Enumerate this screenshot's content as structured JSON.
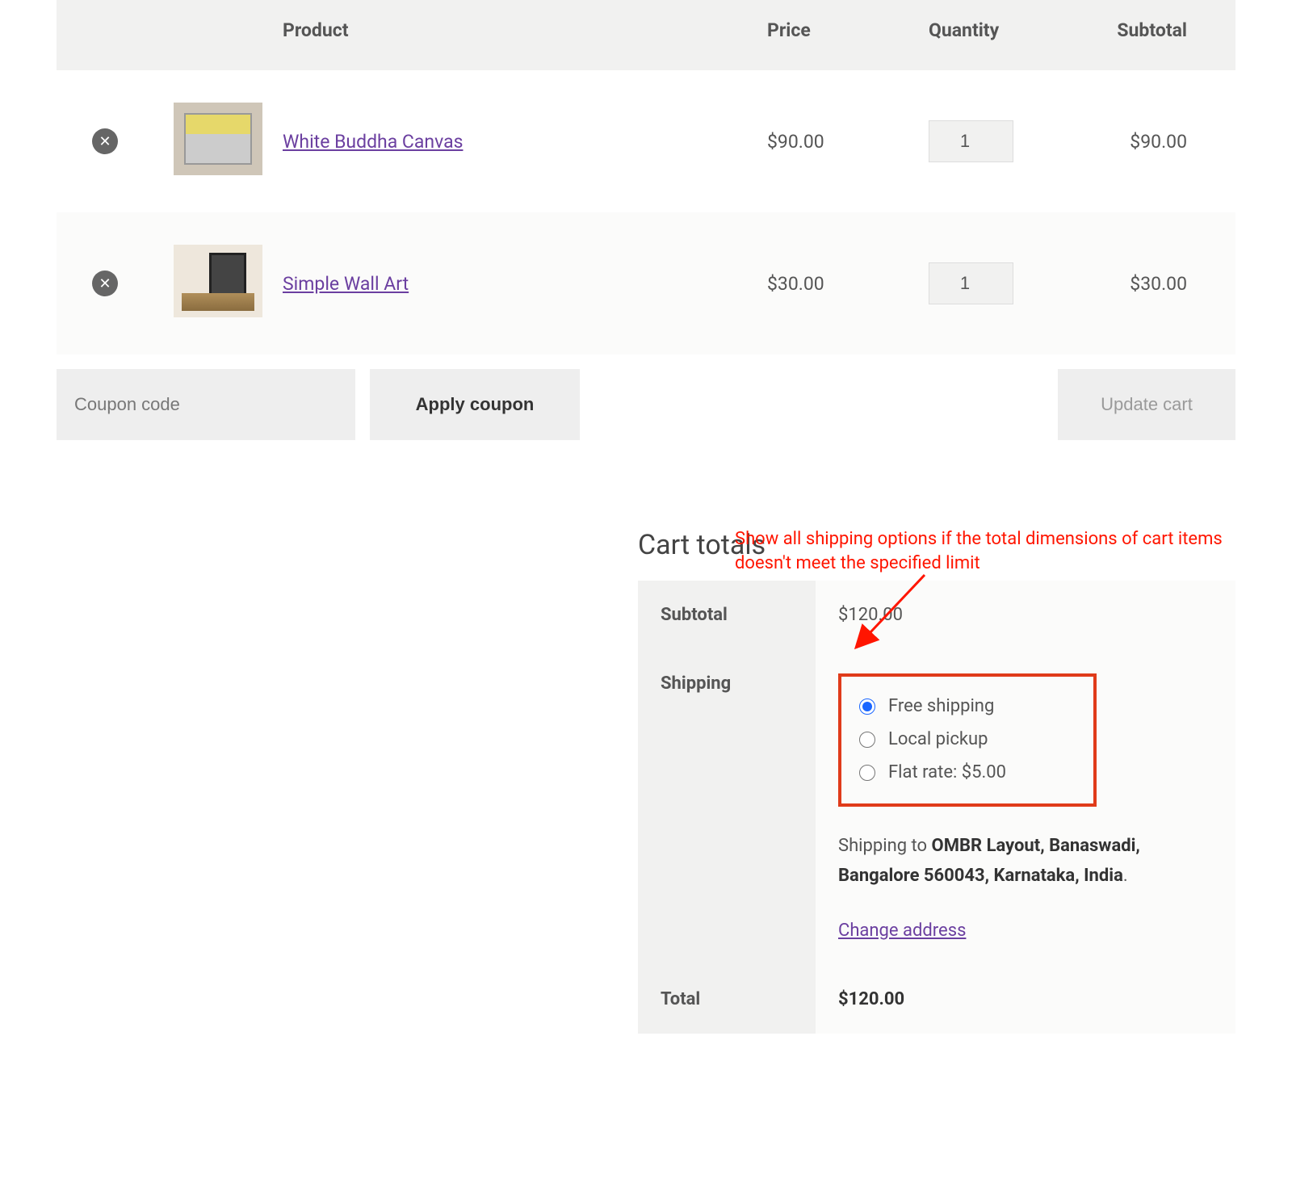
{
  "headers": {
    "product": "Product",
    "price": "Price",
    "quantity": "Quantity",
    "subtotal": "Subtotal"
  },
  "items": [
    {
      "name": "White Buddha Canvas",
      "price": "$90.00",
      "qty": "1",
      "subtotal": "$90.00"
    },
    {
      "name": "Simple Wall Art",
      "price": "$30.00",
      "qty": "1",
      "subtotal": "$30.00"
    }
  ],
  "coupon": {
    "placeholder": "Coupon code",
    "apply_label": "Apply coupon",
    "update_label": "Update cart"
  },
  "totals": {
    "title": "Cart totals",
    "subtotal_label": "Subtotal",
    "subtotal_value": "$120.00",
    "shipping_label": "Shipping",
    "options": {
      "free": "Free shipping",
      "local": "Local pickup",
      "flat": "Flat rate: $5.00"
    },
    "shipping_to_prefix": "Shipping to ",
    "shipping_to_addr": "OMBR Layout, Banaswadi, Bangalore 560043, Karnataka, India",
    "shipping_to_suffix": ".",
    "change_address": "Change address",
    "total_label": "Total",
    "total_value": "$120.00"
  },
  "annotation": {
    "text": "Show all shipping options if the total dimensions of cart items doesn't meet the specified limit"
  }
}
